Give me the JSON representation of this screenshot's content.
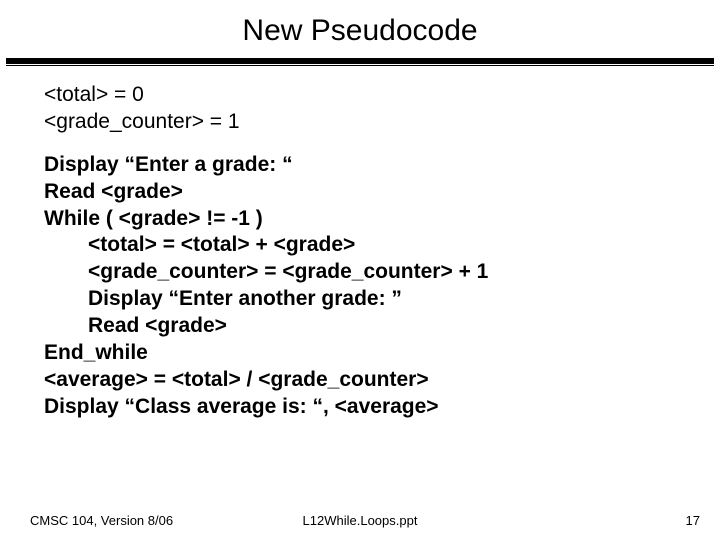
{
  "title": "New Pseudocode",
  "init": {
    "line1": "<total> = 0",
    "line2": "<grade_counter> = 1"
  },
  "code": {
    "l1": "Display “Enter a grade: “",
    "l2": "Read <grade>",
    "l3": "While  ( <grade>  !=  -1 )",
    "l4": "<total> = <total> + <grade>",
    "l5": "<grade_counter> = <grade_counter> + 1",
    "l6": "Display “Enter another grade: ”",
    "l7": "Read <grade>",
    "l8": "End_while",
    "l9": "<average> = <total> / <grade_counter>",
    "l10": "Display “Class average is: “, <average>"
  },
  "footer": {
    "left": "CMSC 104, Version 8/06",
    "center": "L12While.Loops.ppt",
    "right": "17"
  }
}
